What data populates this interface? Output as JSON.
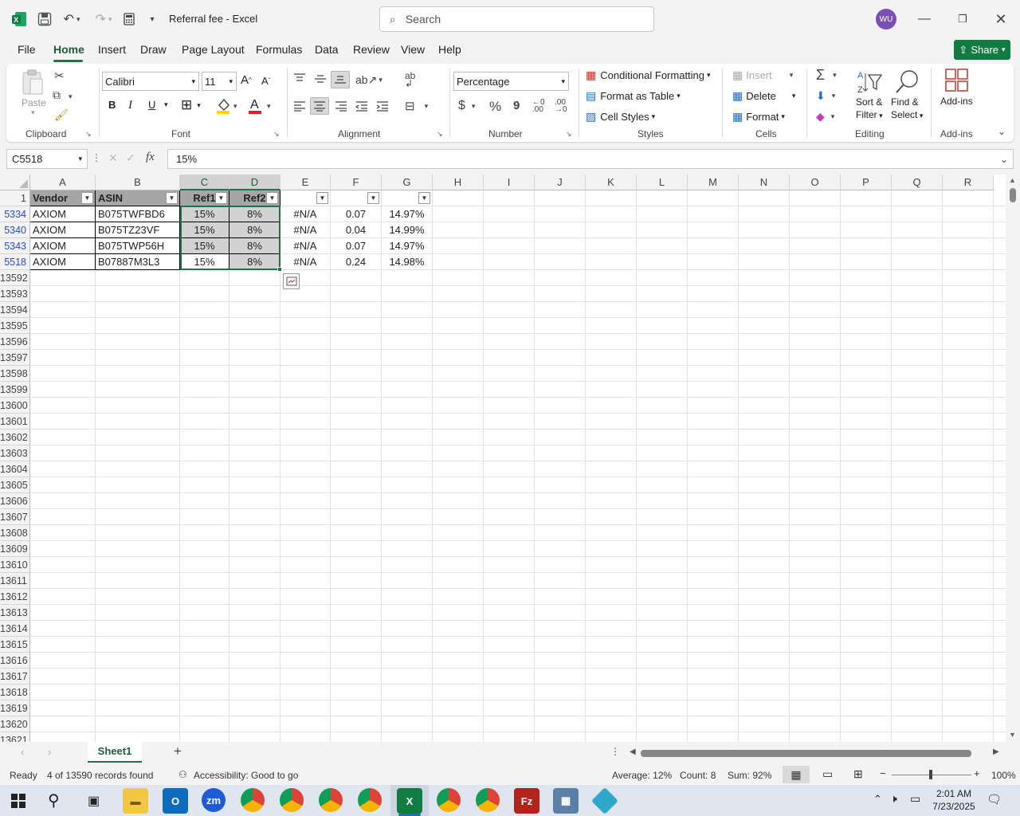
{
  "title": {
    "doc": "Referral fee",
    "sep": "-",
    "app": "Excel"
  },
  "search": {
    "label": "Search"
  },
  "user": {
    "initials": "WU"
  },
  "menu": [
    "File",
    "Home",
    "Insert",
    "Draw",
    "Page Layout",
    "Formulas",
    "Data",
    "Review",
    "View",
    "Help"
  ],
  "share_label": "Share",
  "ribbon": {
    "clipboard": {
      "paste": "Paste",
      "label": "Clipboard"
    },
    "font": {
      "name": "Calibri",
      "size": "11",
      "label": "Font",
      "bold": "B",
      "italic": "I",
      "underline": "U"
    },
    "alignment": {
      "label": "Alignment"
    },
    "number": {
      "format": "Percentage",
      "label": "Number",
      "currency": "$",
      "percent": "%",
      "comma": "9"
    },
    "styles": {
      "cond": "Conditional Formatting",
      "table": "Format as Table",
      "cellstyles": "Cell Styles",
      "label": "Styles"
    },
    "cells": {
      "insert": "Insert",
      "delete": "Delete",
      "format": "Format",
      "label": "Cells"
    },
    "editing": {
      "sort1": "Sort &",
      "sort2": "Filter",
      "find1": "Find &",
      "find2": "Select",
      "label": "Editing"
    },
    "addins": {
      "btn": "Add-ins",
      "label": "Add-ins"
    }
  },
  "formula_bar": {
    "name_box": "C5518",
    "fx": "fx",
    "value": "15%"
  },
  "columns": [
    "A",
    "B",
    "C",
    "D",
    "E",
    "F",
    "G",
    "H",
    "I",
    "J",
    "K",
    "L",
    "M",
    "N",
    "O",
    "P",
    "Q",
    "R"
  ],
  "header_row": {
    "num": "1",
    "A": "Vendor",
    "B": "ASIN",
    "C": "Ref1",
    "D": "Ref2"
  },
  "rows": [
    {
      "num": "5334",
      "A": "AXIOM",
      "B": "B075TWFBD6",
      "C": "15%",
      "D": "8%",
      "E": "#N/A",
      "F": "0.07",
      "G": "14.97%"
    },
    {
      "num": "5340",
      "A": "AXIOM",
      "B": "B075TZ23VF",
      "C": "15%",
      "D": "8%",
      "E": "#N/A",
      "F": "0.04",
      "G": "14.99%"
    },
    {
      "num": "5343",
      "A": "AXIOM",
      "B": "B075TWP56H",
      "C": "15%",
      "D": "8%",
      "E": "#N/A",
      "F": "0.07",
      "G": "14.97%"
    },
    {
      "num": "5518",
      "A": "AXIOM",
      "B": "B07887M3L3",
      "C": "15%",
      "D": "8%",
      "E": "#N/A",
      "F": "0.24",
      "G": "14.98%"
    }
  ],
  "empty_rows": [
    "13592",
    "13593",
    "13594",
    "13595",
    "13596",
    "13597",
    "13598",
    "13599",
    "13600",
    "13601",
    "13602",
    "13603",
    "13604",
    "13605",
    "13606",
    "13607",
    "13608",
    "13609",
    "13610",
    "13611",
    "13612",
    "13613",
    "13614",
    "13615",
    "13616",
    "13617",
    "13618",
    "13619",
    "13620",
    "13621"
  ],
  "sheet_tab": "Sheet1",
  "status": {
    "ready": "Ready",
    "records": "4 of 13590 records found",
    "accessibility": "Accessibility: Good to go",
    "average": "Average: 12%",
    "count": "Count: 8",
    "sum": "Sum: 92%",
    "zoom": "100%"
  },
  "clock": {
    "time": "2:01 AM",
    "date": "7/23/2025"
  },
  "accent": "#217346"
}
